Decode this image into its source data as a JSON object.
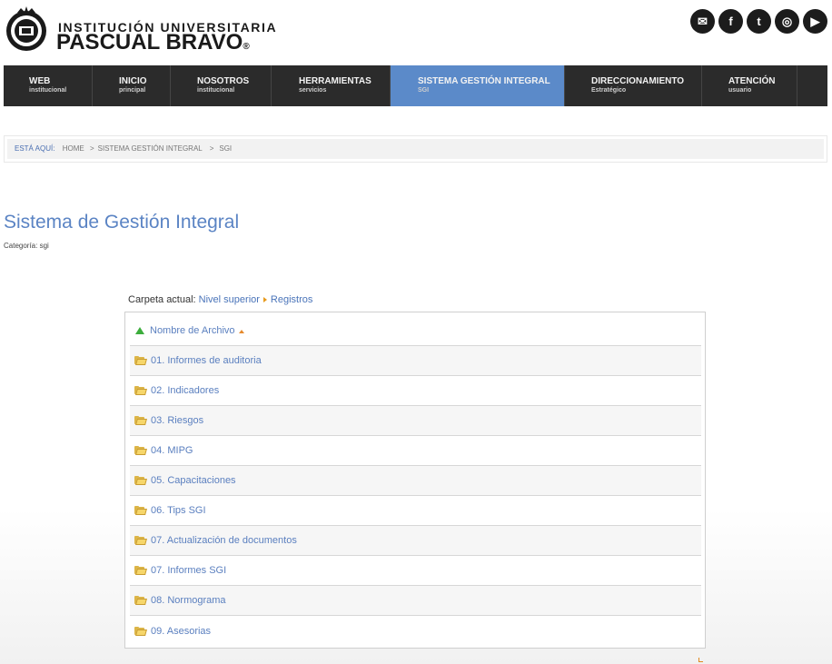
{
  "header": {
    "logo_line1": "INSTITUCIÓN UNIVERSITARIA",
    "logo_line2": "PASCUAL BRAVO",
    "logo_reg": "®",
    "social": [
      {
        "name": "email-icon",
        "glyph": "✉"
      },
      {
        "name": "facebook-icon",
        "glyph": "f"
      },
      {
        "name": "twitter-icon",
        "glyph": "t"
      },
      {
        "name": "instagram-icon",
        "glyph": "◎"
      },
      {
        "name": "youtube-icon",
        "glyph": "▶"
      }
    ]
  },
  "nav": [
    {
      "title": "WEB",
      "subtitle": "institucional"
    },
    {
      "title": "INICIO",
      "subtitle": "principal"
    },
    {
      "title": "NOSOTROS",
      "subtitle": "institucional"
    },
    {
      "title": "HERRAMIENTAS",
      "subtitle": "servicios"
    },
    {
      "title": "SISTEMA GESTIÓN INTEGRAL",
      "subtitle": "SGI",
      "active": true
    },
    {
      "title": "DIRECCIONAMIENTO",
      "subtitle": "Estratégico"
    },
    {
      "title": "ATENCIÓN",
      "subtitle": "usuario"
    }
  ],
  "breadcrumb": {
    "label": "ESTÁ AQUÍ:",
    "items": [
      "HOME",
      "SISTEMA GESTIÓN INTEGRAL",
      "SGI"
    ]
  },
  "page": {
    "title": "Sistema de Gestión Integral",
    "category": "Categoría: sgi"
  },
  "folder_view": {
    "path_label": "Carpeta actual:",
    "path_parent": "Nivel superior",
    "path_current": "Registros",
    "header_label": "Nombre de Archivo",
    "folders": [
      "01. Informes de auditoria",
      "02. Indicadores",
      "03. Riesgos",
      "04. MIPG",
      "05. Capacitaciones",
      "06. Tips SGI",
      "07. Actualización de documentos",
      "07. Informes SGI",
      "08. Normograma",
      "09. Asesorias"
    ]
  },
  "colors": {
    "nav_bg": "#2b2b2b",
    "nav_active": "#5b8ac9",
    "link": "#5a7fbf",
    "title": "#5b84c4"
  }
}
